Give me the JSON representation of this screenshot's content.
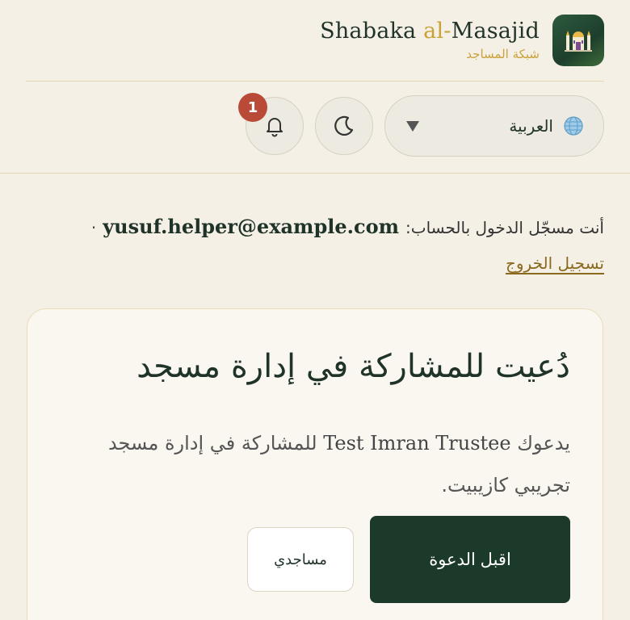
{
  "brand": {
    "title_pre": "Shabaka ",
    "title_accent": "al-",
    "title_post": "Masajid",
    "subtitle": "شبكة المساجد"
  },
  "toolbar": {
    "language_label": "العربية",
    "notification_count": "1"
  },
  "session": {
    "signed_in_prefix": "أنت مسجّل الدخول بالحساب:",
    "email": "yusuf.helper@example.com",
    "separator": "·",
    "logout_label": "تسجيل الخروج"
  },
  "invite": {
    "title": "دُعيت للمشاركة في إدارة مسجد",
    "body_pre": "يدعوك ",
    "inviter": "Test Imran Trustee",
    "body_post": " للمشاركة في إدارة مسجد تجريبي كازيبيت.",
    "accept_label": "اقبل الدعوة",
    "mosques_label": "مساجدي"
  },
  "colors": {
    "background": "#f5f0e6",
    "primary": "#1c3a2a",
    "accent": "#c9a23a",
    "badge": "#b94a38"
  },
  "icons": {
    "logo": "mosque-icon",
    "language": "globe-icon",
    "theme": "moon-icon",
    "notifications": "bell-icon",
    "dropdown": "caret-down-icon"
  }
}
